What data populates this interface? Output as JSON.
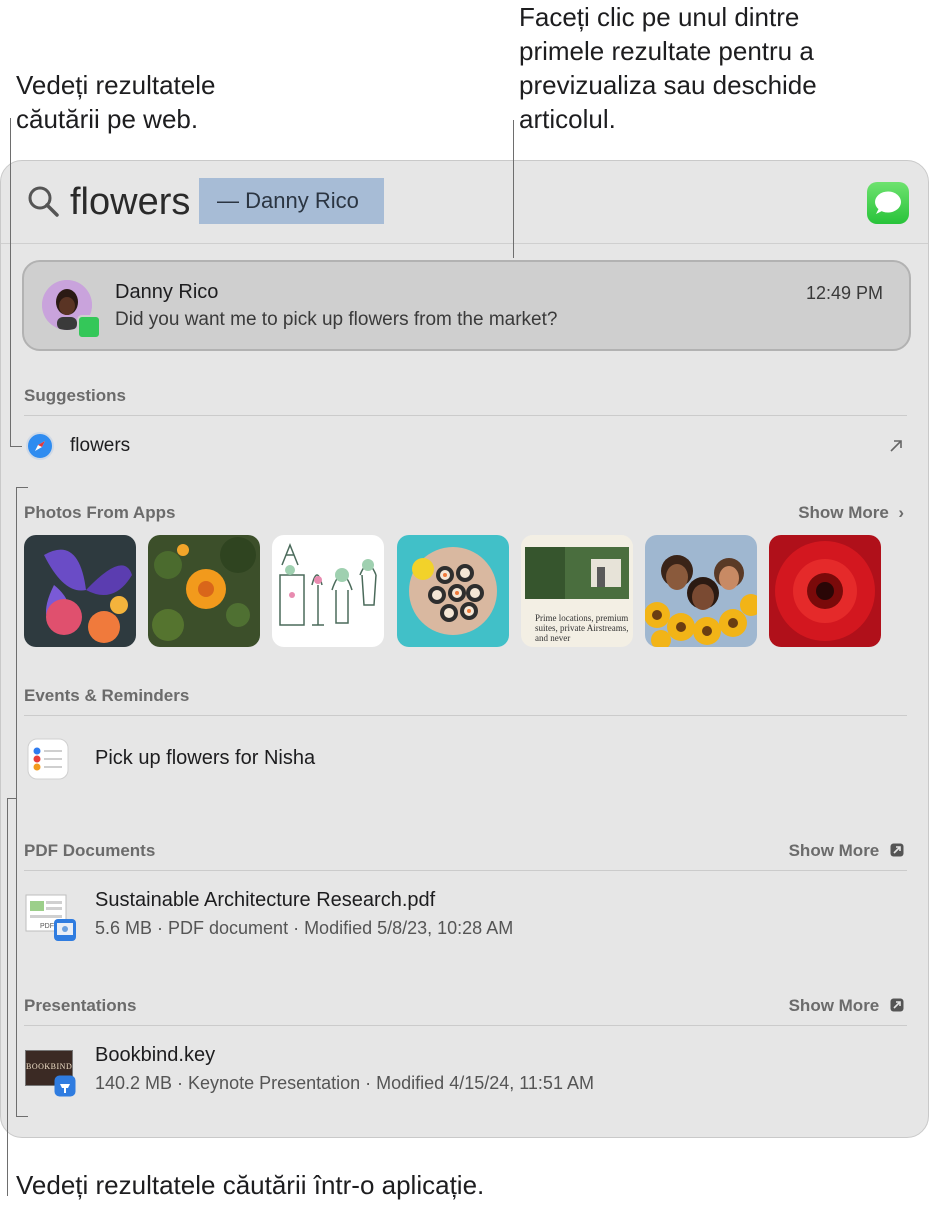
{
  "callouts": {
    "web_results": [
      "Vedeți rezultatele",
      "căutării pe web."
    ],
    "top_results": [
      "Faceți clic pe unul dintre",
      "primele rezultate pentru a",
      "previzualiza sau deschide",
      "articolul."
    ],
    "in_app_results": "Vedeți rezultatele căutării într-o aplicație."
  },
  "search": {
    "query": "flowers",
    "completion": "— Danny Rico",
    "app_icon": "messages-icon"
  },
  "top_hit": {
    "name": "Danny Rico",
    "message": "Did you want me to pick up flowers from the market?",
    "time": "12:49 PM"
  },
  "suggestions": {
    "title": "Suggestions",
    "items": [
      {
        "label": "flowers",
        "icon": "safari-icon",
        "action_icon": "arrow-up-right-icon"
      }
    ]
  },
  "photos": {
    "title": "Photos From Apps",
    "show_more": "Show More",
    "items": [
      {
        "name": "iris-flowers",
        "colors": [
          "#5a3fa8",
          "#d44a6a"
        ]
      },
      {
        "name": "orange-marigold",
        "colors": [
          "#3d5a25",
          "#f29a1c"
        ]
      },
      {
        "name": "plant-sketch",
        "colors": [
          "#ffffff",
          "#8fbfa0"
        ]
      },
      {
        "name": "sushi-plate",
        "colors": [
          "#3bbfc6",
          "#f4c9a0"
        ]
      },
      {
        "name": "article-preview",
        "colors": [
          "#f3efe4",
          "#3f6a3a"
        ],
        "caption": "Prime locations, premium suites, private Airstreams, and never"
      },
      {
        "name": "sunflower-friends",
        "colors": [
          "#f2b417",
          "#5d3a24"
        ]
      },
      {
        "name": "red-gerbera",
        "colors": [
          "#c8141c",
          "#2a0a0a"
        ]
      }
    ]
  },
  "events": {
    "title": "Events & Reminders",
    "items": [
      {
        "title": "Pick up flowers for Nisha",
        "icon": "reminders-icon"
      }
    ]
  },
  "pdfs": {
    "title": "PDF Documents",
    "show_more": "Show More",
    "items": [
      {
        "title": "Sustainable Architecture Research.pdf",
        "subtitle": "5.6 MB · PDF document · Modified 5/8/23, 10:28 AM",
        "icon": "pdf-preview-icon"
      }
    ]
  },
  "presentations": {
    "title": "Presentations",
    "show_more": "Show More",
    "items": [
      {
        "title": "Bookbind.key",
        "subtitle": "140.2 MB · Keynote Presentation · Modified 4/15/24, 11:51 AM",
        "icon": "keynote-icon",
        "thumb_text": "BOOKBIND"
      }
    ]
  }
}
